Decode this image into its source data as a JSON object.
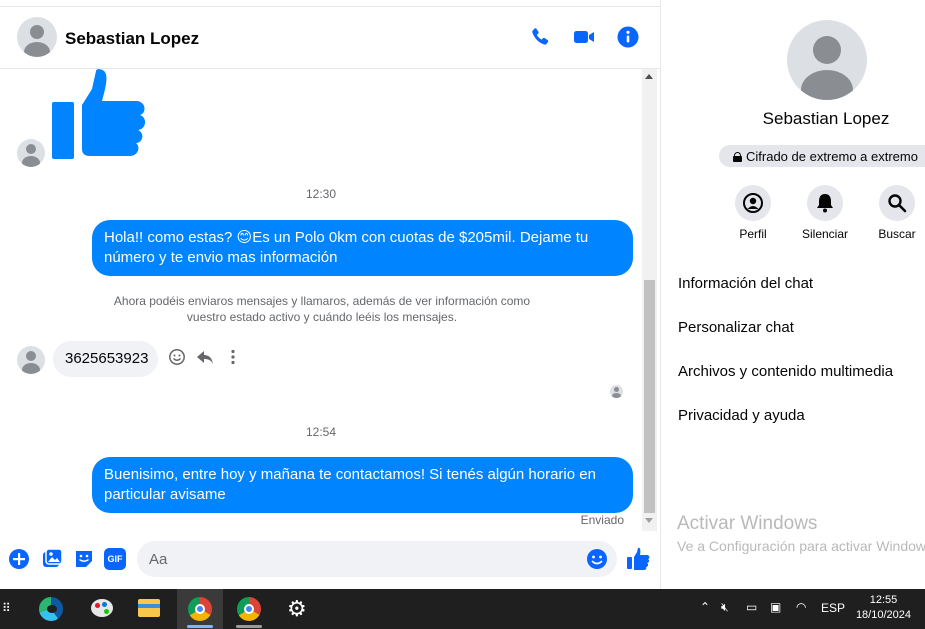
{
  "header": {
    "contact_name": "Sebastian Lopez",
    "icons": [
      "phone-icon",
      "video-icon",
      "info-icon"
    ]
  },
  "messages": {
    "time_1": "12:30",
    "out_1": "Hola!! como estas? 😊Es un Polo 0km con cuotas de $205mil. Dejame tu número y te envio mas información",
    "info_notice": "Ahora podéis enviaros mensajes y llamaros, además de ver información como vuestro estado activo y cuándo leéis los mensajes.",
    "in_1": "3625653923",
    "time_2": "12:54",
    "out_2": "Buenisimo, entre hoy y mañana te contactamos! Si tenés algún horario en particular avisame",
    "sent_status": "Enviado"
  },
  "composer": {
    "placeholder": "Aa",
    "gif_label": "GIF"
  },
  "panel": {
    "name": "Sebastian Lopez",
    "encryption": "Cifrado de extremo a extremo",
    "actions": [
      {
        "label": "Perfil",
        "icon": "profile-icon"
      },
      {
        "label": "Silenciar",
        "icon": "bell-icon"
      },
      {
        "label": "Buscar",
        "icon": "search-icon"
      }
    ],
    "menu": [
      "Información del chat",
      "Personalizar chat",
      "Archivos y contenido multimedia",
      "Privacidad y ayuda"
    ],
    "watermark_title": "Activar Windows",
    "watermark_sub": "Ve a Configuración para activar Windows."
  },
  "taskbar": {
    "lang": "ESP",
    "time": "12:55",
    "date": "18/10/2024"
  },
  "colors": {
    "accent": "#0084ff",
    "messenger_blue": "#0866ff"
  }
}
